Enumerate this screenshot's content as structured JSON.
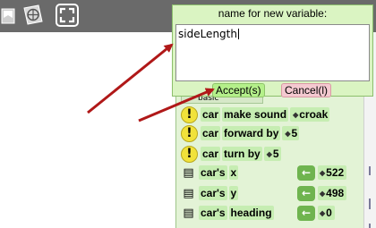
{
  "toolbar": {
    "icons": [
      "bookmark-flag-icon",
      "globe-page-icon",
      "fullscreen-icon"
    ]
  },
  "dialog": {
    "title": "name for new variable:",
    "input_value": "sideLength",
    "accept_label": "Accept(s)",
    "cancel_label": "Cancel(l)"
  },
  "palette": {
    "category_partial": "basic",
    "blocks": [
      {
        "icon": "exclamation-icon",
        "subject": "car",
        "verb": "make sound",
        "arg": "croak"
      },
      {
        "icon": "exclamation-icon",
        "subject": "car",
        "verb": "forward by",
        "arg": "5"
      },
      {
        "icon": "exclamation-icon",
        "subject": "car",
        "verb": "turn by",
        "arg": "5"
      },
      {
        "icon": "document-icon",
        "subject": "car's",
        "verb": "x",
        "arg": "522"
      },
      {
        "icon": "document-icon",
        "subject": "car's",
        "verb": "y",
        "arg": "498"
      },
      {
        "icon": "document-icon",
        "subject": "car's",
        "verb": "heading",
        "arg": "0"
      }
    ]
  },
  "colors": {
    "toolbar_bg": "#6a6a6a",
    "panel_bg": "#e3f3d6",
    "block_bg": "#c6edb2",
    "accept_bg": "#b4f08a",
    "cancel_bg": "#f4c9d0",
    "annotation_arrow": "#b01818"
  }
}
